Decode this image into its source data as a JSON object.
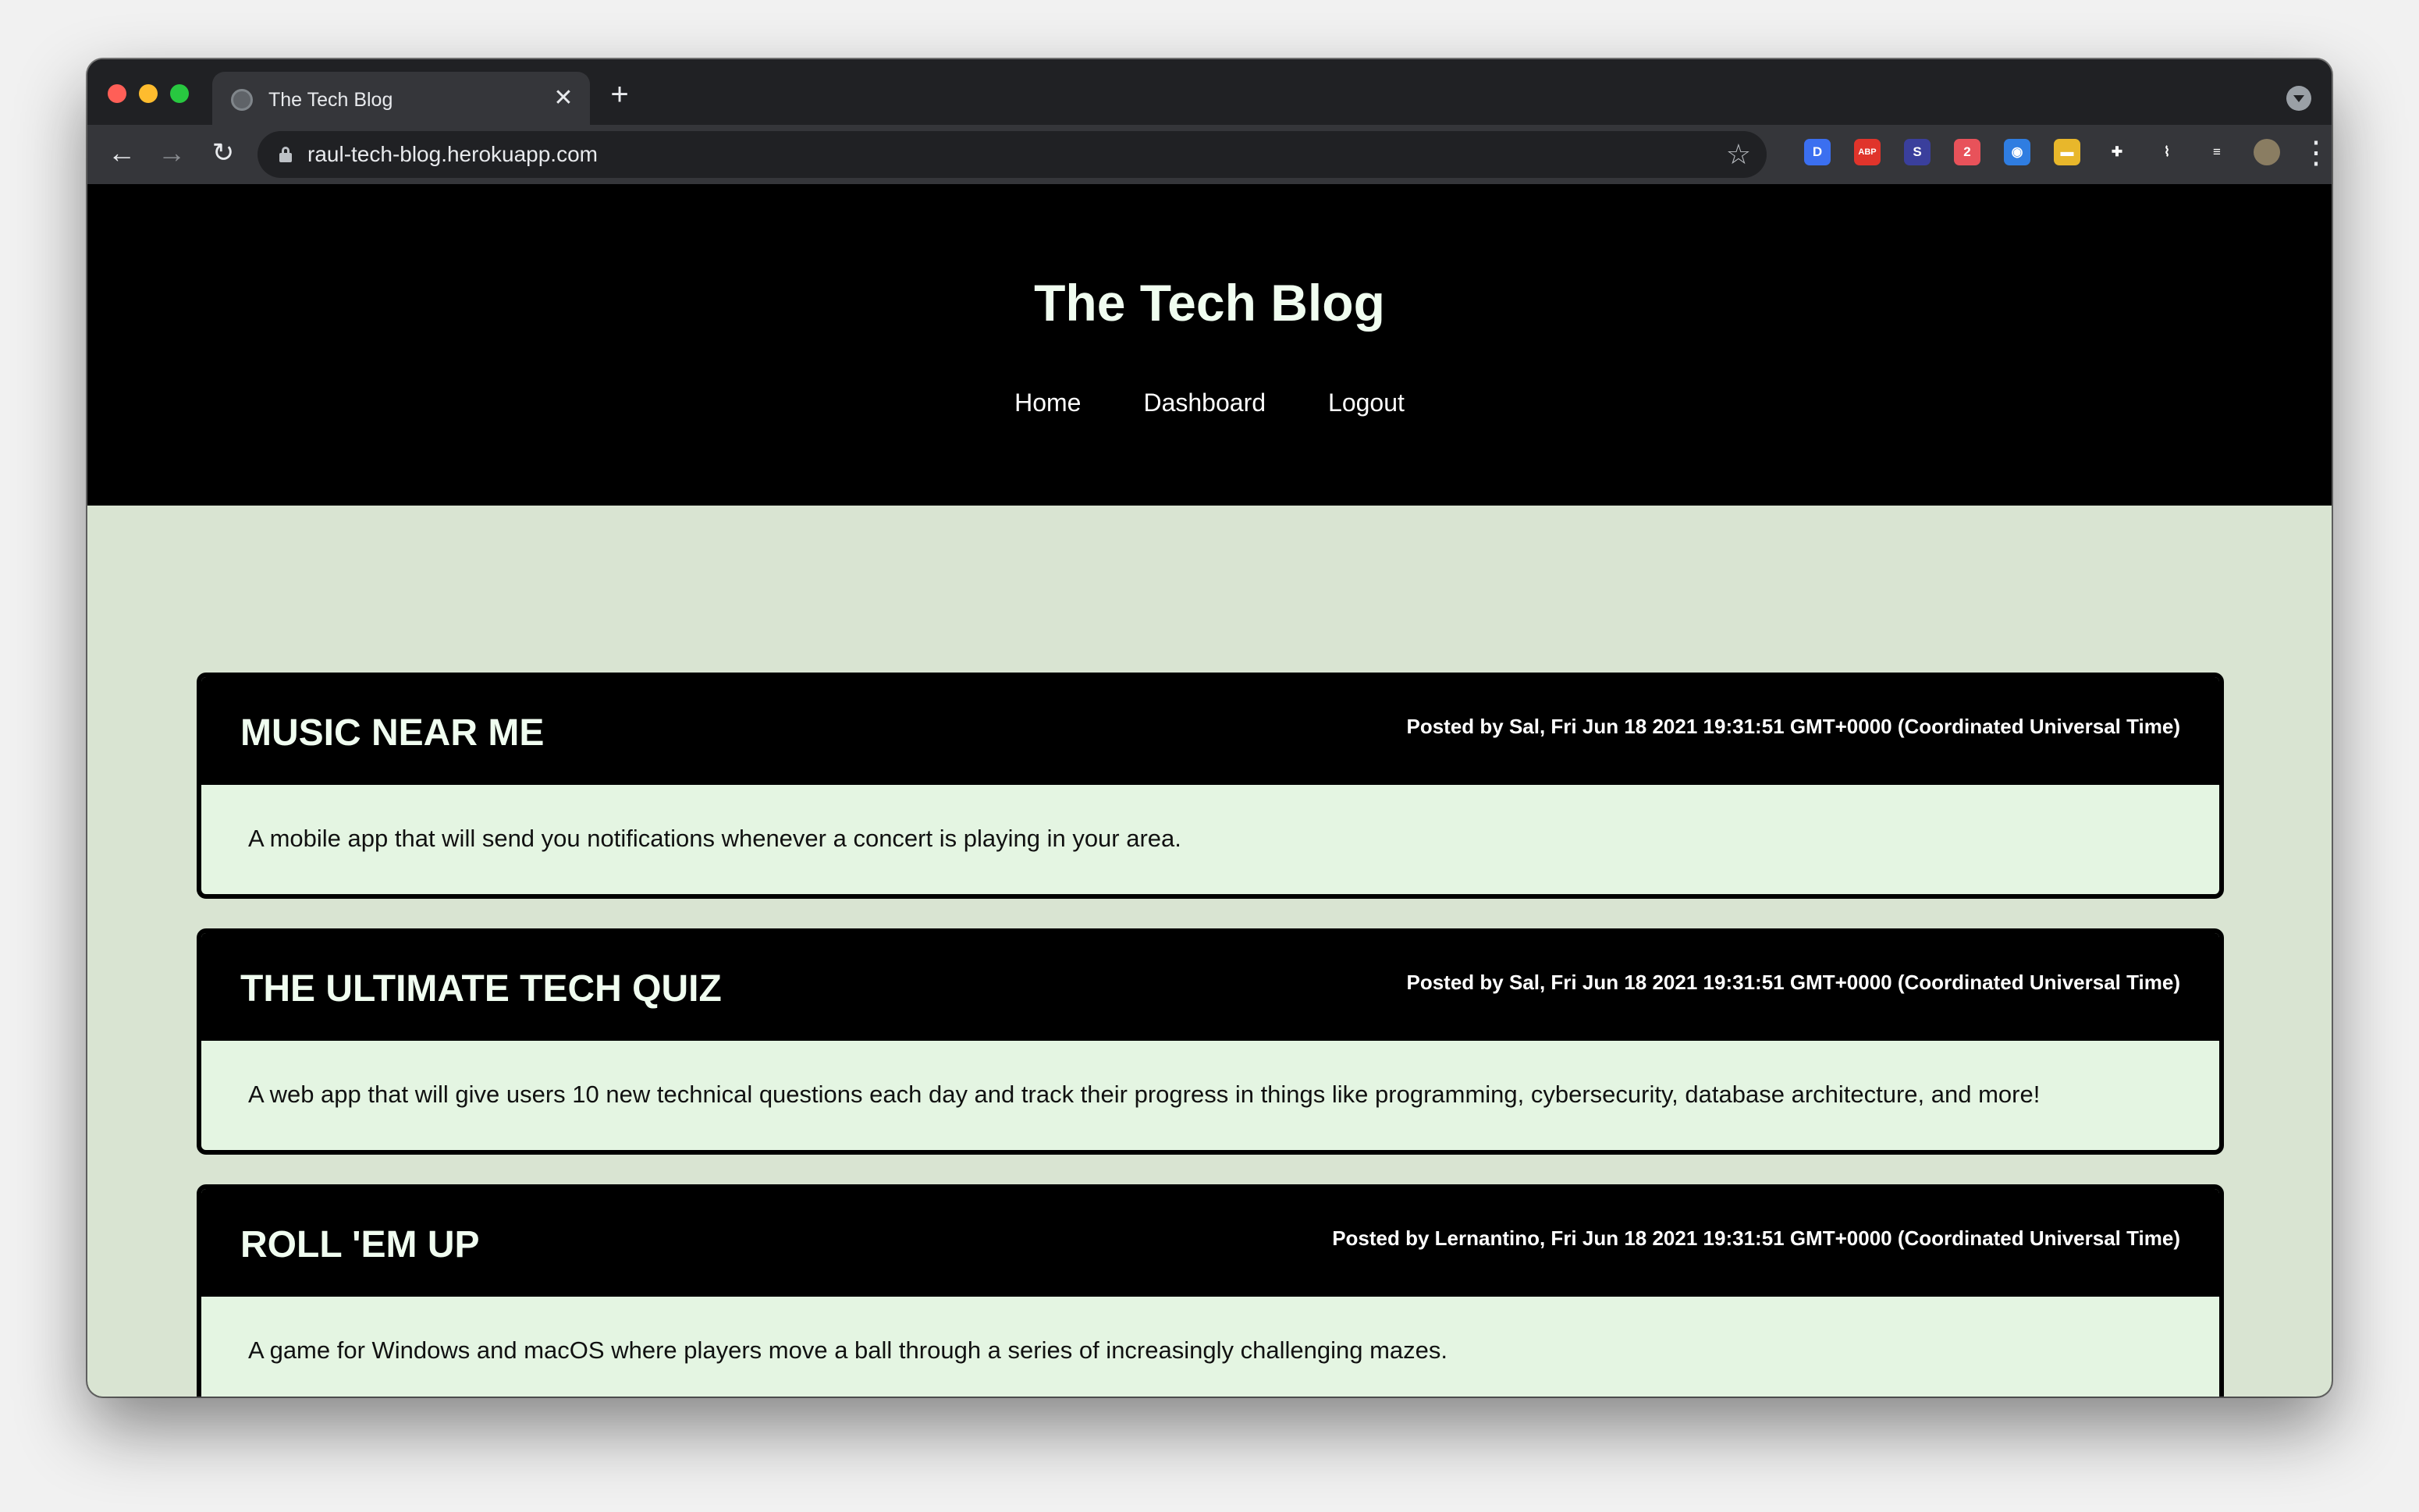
{
  "browser": {
    "tab_title": "The Tech Blog",
    "tab_close": "✕",
    "new_tab": "+",
    "url": "raul-tech-blog.herokuapp.com",
    "nav": {
      "back": "←",
      "forward": "→",
      "reload": "↻"
    },
    "star": "☆",
    "menu": "⋮",
    "extensions": [
      {
        "name": "d-extension-icon",
        "label": "D",
        "color": "#3b6ff0"
      },
      {
        "name": "abp-extension-icon",
        "label": "ABP",
        "color": "#e0342b"
      },
      {
        "name": "s-extension-icon",
        "label": "S",
        "color": "#3a3f9c"
      },
      {
        "name": "badge-extension-icon",
        "label": "2",
        "color": "#e8525a"
      },
      {
        "name": "camera-extension-icon",
        "label": "◉",
        "color": "#2f7de1"
      },
      {
        "name": "flag-extension-icon",
        "label": "▬",
        "color": "#e8b72b"
      },
      {
        "name": "puzzle-extension-icon",
        "label": "✚",
        "color": "#35363a"
      },
      {
        "name": "cast-icon",
        "label": "⌇",
        "color": "#35363a"
      },
      {
        "name": "playlist-icon",
        "label": "≡",
        "color": "#35363a"
      },
      {
        "name": "profile-avatar",
        "label": "",
        "color": "#8a7d62"
      }
    ]
  },
  "site": {
    "title": "The Tech Blog",
    "nav": [
      "Home",
      "Dashboard",
      "Logout"
    ]
  },
  "posts": [
    {
      "title": "MUSIC NEAR ME",
      "meta": "Posted by Sal, Fri Jun 18 2021 19:31:51 GMT+0000 (Coordinated Universal Time)",
      "body": "A mobile app that will send you notifications whenever a concert is playing in your area."
    },
    {
      "title": "THE ULTIMATE TECH QUIZ",
      "meta": "Posted by Sal, Fri Jun 18 2021 19:31:51 GMT+0000 (Coordinated Universal Time)",
      "body": "A web app that will give users 10 new technical questions each day and track their progress in things like programming, cybersecurity, database architecture, and more!"
    },
    {
      "title": "ROLL 'EM UP",
      "meta": "Posted by Lernantino, Fri Jun 18 2021 19:31:51 GMT+0000 (Coordinated Universal Time)",
      "body": "A game for Windows and macOS where players move a ball through a series of increasingly challenging mazes."
    }
  ]
}
